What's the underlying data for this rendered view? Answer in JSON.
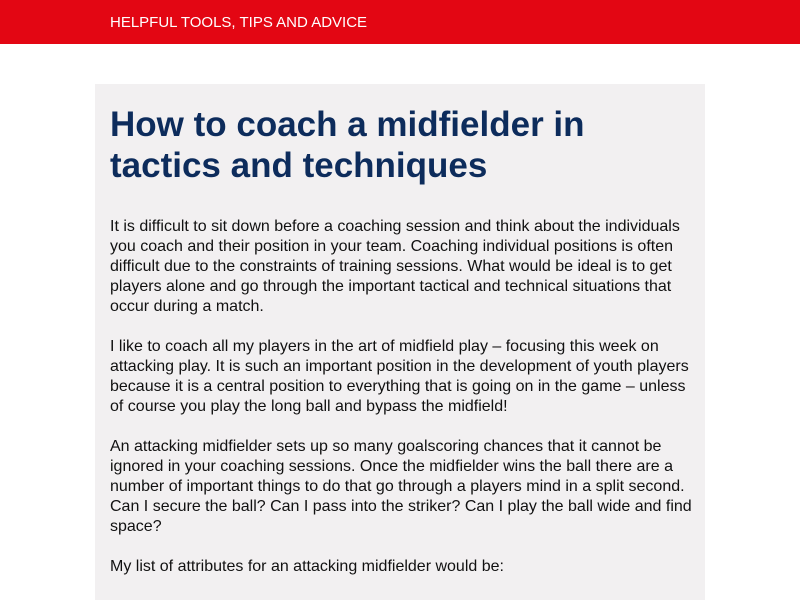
{
  "header": {
    "tagline": "HELPFUL TOOLS, TIPS AND ADVICE",
    "background_color": "#e30613"
  },
  "article": {
    "title": "How to coach a midfielder in tactics and techniques",
    "title_color": "#0d2c5c",
    "background_color": "#f2f0f1",
    "paragraphs": [
      "It is difficult to sit down before a coaching session and think about the individuals you coach and their position in your team. Coaching individual positions is often difficult due to the constraints of training sessions. What would be ideal is to get players alone and go through the important tactical and technical situations that occur during a match.",
      "I like to coach all my players in the art of midfield play – focusing this week on attacking play. It is such an important position in the development of youth players because it is a central position to everything that is going on in the game – unless of course you play the long ball and bypass the midfield!",
      "An attacking midfielder sets up so many goalscoring chances that it cannot be ignored in your coaching sessions. Once the midfielder wins the ball there are a number of important things to do that go through a players mind in a split second. Can I secure the ball? Can I pass into the striker? Can I play the ball wide and find space?",
      "My list of attributes for an attacking midfielder would be:"
    ]
  }
}
